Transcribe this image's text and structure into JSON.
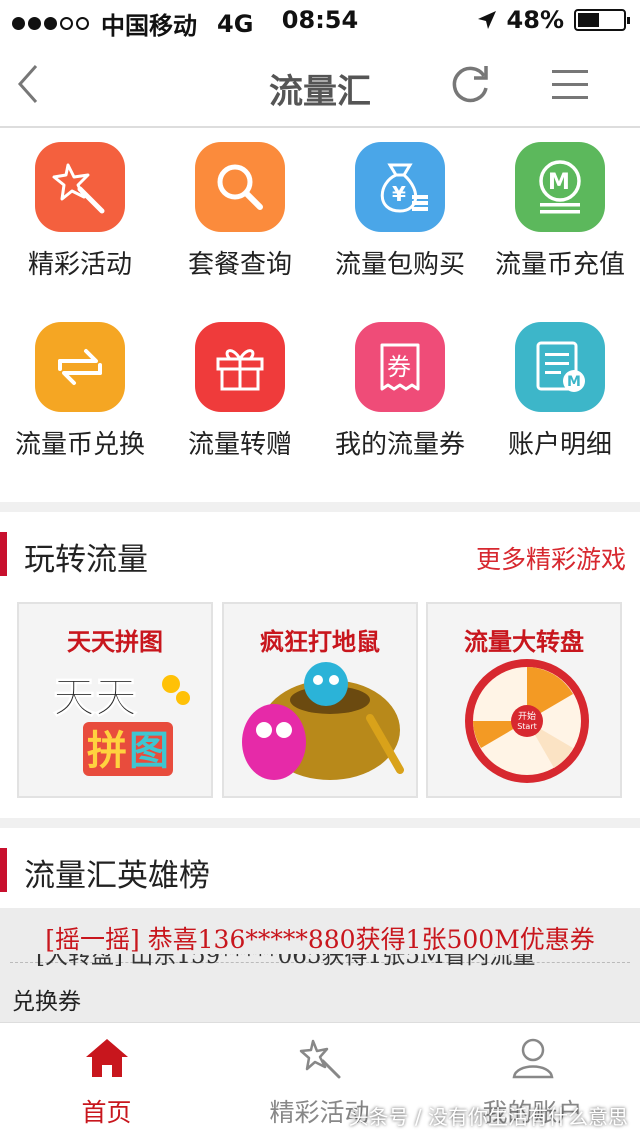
{
  "status_bar": {
    "carrier": "中国移动",
    "network": "4G",
    "time": "08:54",
    "battery": "48%"
  },
  "nav": {
    "title": "流量汇",
    "back_icon": "back-chevron-icon",
    "refresh_icon": "refresh-icon",
    "menu_icon": "hamburger-menu-icon"
  },
  "grid": [
    {
      "label": "精彩活动",
      "icon": "magic-wand-icon",
      "color": "#f4603e"
    },
    {
      "label": "套餐查询",
      "icon": "search-icon",
      "color": "#fb8b3c"
    },
    {
      "label": "流量包购买",
      "icon": "money-bag-icon",
      "color": "#4aa6e8"
    },
    {
      "label": "流量币充值",
      "icon": "coin-m-icon",
      "color": "#5cb85c"
    },
    {
      "label": "流量币兑换",
      "icon": "exchange-arrows-icon",
      "color": "#f5a623"
    },
    {
      "label": "流量转赠",
      "icon": "gift-icon",
      "color": "#ef3b3b"
    },
    {
      "label": "我的流量券",
      "icon": "coupon-icon",
      "color": "#ef4c78"
    },
    {
      "label": "账户明细",
      "icon": "account-bill-icon",
      "color": "#3db6c9"
    }
  ],
  "play_section": {
    "title": "玩转流量",
    "more": "更多精彩游戏"
  },
  "games": [
    {
      "title": "天天拼图",
      "art": "天天\n拼图"
    },
    {
      "title": "疯狂打地鼠"
    },
    {
      "title": "流量大转盘",
      "wheel_center_1": "开始",
      "wheel_center_2": "Start"
    }
  ],
  "heroes_section": {
    "title": "流量汇英雄榜"
  },
  "ticker": {
    "line1": "[摇一摇] 恭喜136*****880获得1张500M优惠券",
    "line2": "[大转盘]      山东159*****065获得1张5M省内流量",
    "line3": "兑换券"
  },
  "tabs": [
    {
      "label": "首页",
      "icon": "home-icon",
      "active": true
    },
    {
      "label": "精彩活动",
      "icon": "magic-wand-icon"
    },
    {
      "label": "我的账户",
      "icon": "user-icon"
    }
  ],
  "watermark": "头条号 / 没有你生活有什么意思",
  "colors": {
    "accent": "#c8161d",
    "section_bar": "#c8102e"
  }
}
